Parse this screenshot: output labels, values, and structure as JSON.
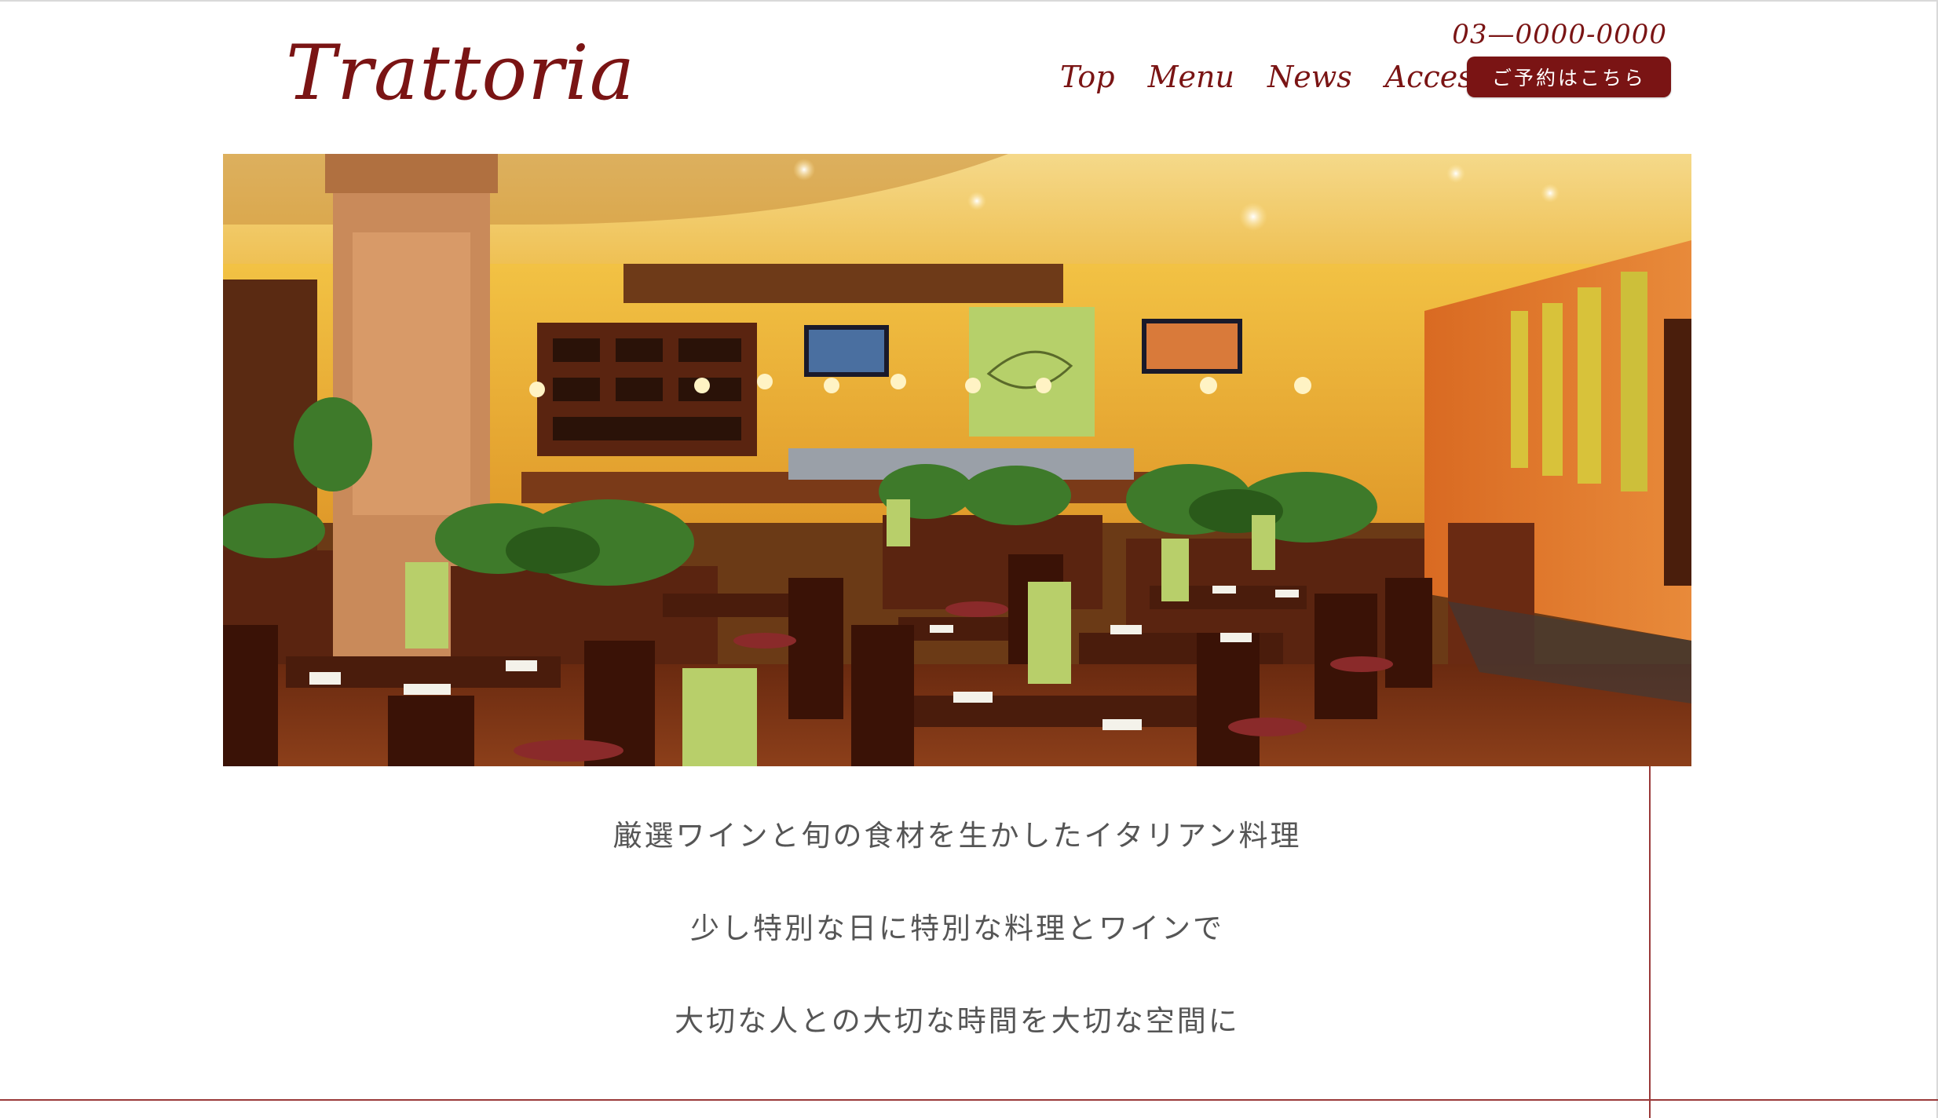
{
  "header": {
    "logo": "Trattoria",
    "phone": "03—0000-0000",
    "nav": [
      {
        "label": "Top"
      },
      {
        "label": "Menu"
      },
      {
        "label": "News"
      },
      {
        "label": "Access"
      }
    ],
    "reserve_label": "ご予約はこちら"
  },
  "hero": {
    "image": "restaurant-interior-photo"
  },
  "intro": {
    "lines": [
      "厳選ワインと旬の食材を生かしたイタリアン料理",
      "少し特別な日に特別な料理とワインで",
      "大切な人との大切な時間を大切な空間に"
    ]
  },
  "colors": {
    "brand": "#7a1414",
    "text": "#555555",
    "rule": "#9a3a3a"
  }
}
